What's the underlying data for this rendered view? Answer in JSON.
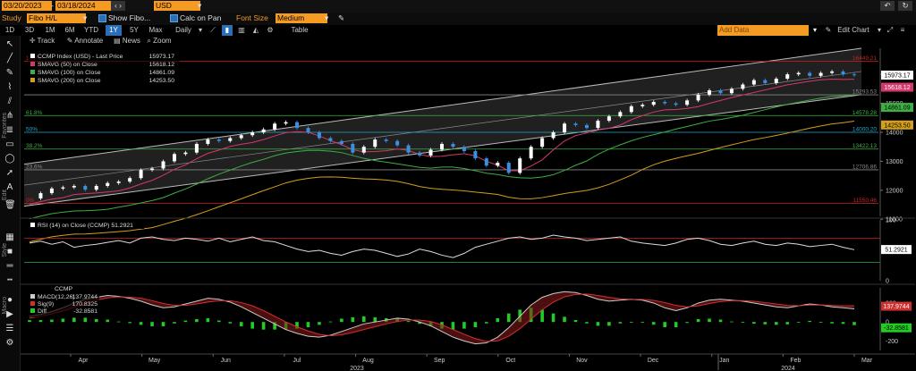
{
  "toolbar1": {
    "start_date": "03/20/2023",
    "end_date": "03/18/2024",
    "currency": "USD",
    "study_label": "Study",
    "study_value": "Fibo H/L",
    "show_fibo": "Show Fibo...",
    "calc_on_pan": "Calc on Pan",
    "font_size_label": "Font Size",
    "font_size_value": "Medium"
  },
  "toolbar2": {
    "ranges": [
      "1D",
      "3D",
      "1M",
      "6M",
      "YTD",
      "1Y",
      "5Y",
      "Max"
    ],
    "selected_range": "1Y",
    "interval": "Daily",
    "table_label": "Table",
    "add_data_placeholder": "Add Data",
    "edit_chart": "Edit Chart"
  },
  "toolbar3": {
    "track": "Track",
    "annotate": "Annotate",
    "news": "News",
    "zoom": "Zoom"
  },
  "side_labels": {
    "edit": "Edit",
    "style": "Style",
    "favorites": "Favorites",
    "macro": "Macro"
  },
  "colors": {
    "accent_orange": "#f59a23",
    "price_up": "#ffffff",
    "price_down": "#3a8fe0",
    "sma50": "#d4386b",
    "sma100": "#3cb043",
    "sma200": "#d4a017",
    "macd": "#cccccc",
    "signal": "#d03030",
    "diff": "#22cc22"
  },
  "chart_data": [
    {
      "type": "candlestick-line",
      "title": "CCMP Index (USD) - Last Price 15973.17",
      "legend": [
        {
          "name": "CCMP Index (USD) - Last Price",
          "value": "15973.17",
          "color": "#ffffff"
        },
        {
          "name": "SMAVG (50) on Close",
          "value": "15618.12",
          "color": "#d4386b"
        },
        {
          "name": "SMAVG (100) on Close",
          "value": "14861.09",
          "color": "#3cb043"
        },
        {
          "name": "SMAVG (200) on Close",
          "value": "14253.50",
          "color": "#d4a017"
        }
      ],
      "y_ticks": [
        11000,
        12000,
        13000,
        14000,
        15000,
        16000
      ],
      "ylim": [
        11100,
        16900
      ],
      "right_labels": [
        {
          "value": "15973.17",
          "bg": "#ffffff",
          "fg": "#000"
        },
        {
          "value": "15618.12",
          "bg": "#d4386b",
          "fg": "#fff"
        },
        {
          "value": "14861.09",
          "bg": "#3cb043",
          "fg": "#000"
        },
        {
          "value": "14253.50",
          "bg": "#d4a017",
          "fg": "#000"
        }
      ],
      "fib_levels": [
        {
          "pct": "100%",
          "value": "16449.21",
          "color": "#cc2222"
        },
        {
          "pct": "",
          "value": "15293.53",
          "color": "#888888"
        },
        {
          "pct": "61.8%",
          "value": "14578.28",
          "color": "#3cb043"
        },
        {
          "pct": "50%",
          "value": "14000.20",
          "color": "#22aacc"
        },
        {
          "pct": "38.2%",
          "value": "13422.13",
          "color": "#3cb043"
        },
        {
          "pct": "23.6%",
          "value": "12706.86",
          "color": "#888888"
        },
        {
          "pct": "0%",
          "value": "11550.46",
          "color": "#cc2222"
        }
      ],
      "months": [
        "Apr",
        "May",
        "Jun",
        "Jul",
        "Aug",
        "Sep",
        "Oct",
        "Nov",
        "Dec",
        "Jan",
        "Feb",
        "Mar"
      ],
      "years": [
        "2023",
        "2024"
      ],
      "close_series": [
        11718,
        11900,
        12060,
        12100,
        12150,
        12020,
        12150,
        12250,
        12300,
        12420,
        12700,
        12750,
        13000,
        13250,
        13300,
        13600,
        13750,
        13700,
        13800,
        13900,
        14000,
        14100,
        14300,
        14350,
        14150,
        14000,
        13800,
        13700,
        13600,
        13300,
        13500,
        13750,
        13700,
        13550,
        13300,
        13200,
        13400,
        13600,
        13500,
        13350,
        13100,
        12850,
        12950,
        12600,
        13100,
        13500,
        13800,
        14000,
        14300,
        14250,
        14150,
        14400,
        14550,
        14700,
        14900,
        14950,
        15050,
        15000,
        14950,
        15100,
        15300,
        15450,
        15350,
        15500,
        15650,
        15800,
        15700,
        15850,
        16000,
        16050,
        15950,
        16050,
        16100,
        16000,
        15973
      ]
    },
    {
      "type": "line",
      "title": "RSI (14) on Close (CCMP) 51.2921",
      "legend": [
        {
          "name": "RSI (14) on Close (CCMP)",
          "value": "51.2921",
          "color": "#ffffff"
        }
      ],
      "y_ticks": [
        0,
        50,
        100
      ],
      "right_label": "51.2921",
      "ylim": [
        0,
        100
      ],
      "values": [
        62,
        65,
        60,
        64,
        55,
        58,
        60,
        63,
        66,
        62,
        70,
        72,
        68,
        66,
        70,
        68,
        65,
        70,
        64,
        68,
        72,
        66,
        64,
        58,
        52,
        48,
        50,
        45,
        42,
        48,
        52,
        50,
        45,
        40,
        44,
        52,
        48,
        42,
        38,
        45,
        55,
        60,
        65,
        70,
        72,
        68,
        70,
        75,
        72,
        70,
        66,
        68,
        70,
        72,
        65,
        62,
        60,
        58,
        62,
        68,
        70,
        66,
        60,
        58,
        62,
        65,
        60,
        58,
        62,
        60,
        56,
        58,
        60,
        55,
        51
      ]
    },
    {
      "type": "line+bar",
      "title": "CCMP",
      "legend": [
        {
          "name": "MACD(12,26)",
          "value": "137.9744",
          "color": "#cccccc"
        },
        {
          "name": "Sig(9)",
          "value": "170.8325",
          "color": "#d03030"
        },
        {
          "name": "Diff",
          "value": "-32.8581",
          "color": "#22cc22"
        }
      ],
      "y_ticks": [
        200,
        0,
        -200
      ],
      "right_labels": [
        {
          "value": "137.9744",
          "bg": "#d03030",
          "fg": "#fff"
        },
        {
          "value": "-32.8581",
          "bg": "#22cc22",
          "fg": "#000"
        }
      ],
      "ylim": [
        -300,
        360
      ],
      "macd": [
        60,
        80,
        110,
        150,
        200,
        240,
        260,
        280,
        270,
        250,
        220,
        180,
        150,
        160,
        190,
        220,
        250,
        240,
        210,
        160,
        100,
        40,
        -20,
        -80,
        -120,
        -150,
        -160,
        -140,
        -100,
        -60,
        -20,
        0,
        20,
        40,
        30,
        0,
        -40,
        -100,
        -160,
        -200,
        -230,
        -220,
        -160,
        -60,
        60,
        180,
        260,
        300,
        320,
        310,
        280,
        240,
        220,
        230,
        240,
        230,
        200,
        150,
        120,
        150,
        200,
        230,
        240,
        230,
        220,
        200,
        180,
        160,
        150,
        170,
        190,
        180,
        160,
        150,
        138
      ],
      "signal": [
        40,
        60,
        85,
        115,
        155,
        195,
        230,
        255,
        265,
        262,
        250,
        225,
        195,
        175,
        175,
        190,
        210,
        225,
        225,
        205,
        170,
        120,
        60,
        0,
        -50,
        -95,
        -130,
        -145,
        -135,
        -110,
        -80,
        -50,
        -20,
        5,
        20,
        20,
        5,
        -30,
        -80,
        -130,
        -175,
        -205,
        -200,
        -150,
        -70,
        30,
        130,
        210,
        265,
        290,
        295,
        280,
        260,
        245,
        240,
        238,
        228,
        205,
        175,
        160,
        170,
        195,
        215,
        225,
        226,
        218,
        205,
        190,
        175,
        172,
        178,
        180,
        175,
        170,
        171
      ]
    }
  ]
}
